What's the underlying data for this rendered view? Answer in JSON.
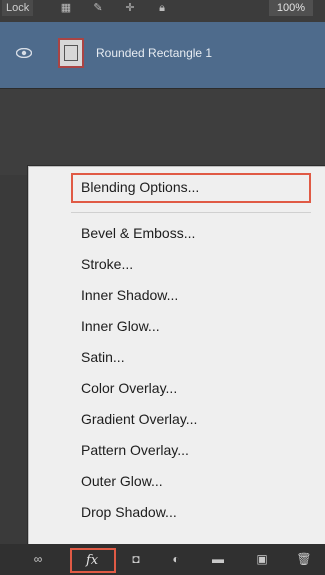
{
  "top_bar": {
    "lock_label": "Lock",
    "fill_value": "100%"
  },
  "layer": {
    "name": "Rounded Rectangle 1"
  },
  "fx_menu": {
    "items": [
      "Blending Options...",
      "Bevel & Emboss...",
      "Stroke...",
      "Inner Shadow...",
      "Inner Glow...",
      "Satin...",
      "Color Overlay...",
      "Gradient Overlay...",
      "Pattern Overlay...",
      "Outer Glow...",
      "Drop Shadow..."
    ],
    "highlighted_item": "Blending Options..."
  },
  "bottom_toolbar": {
    "fx_label": "fx",
    "icons": [
      "link-layers-icon",
      "fx-icon",
      "add-mask-icon",
      "adjustment-layer-icon",
      "new-group-folder-icon",
      "new-layer-icon",
      "delete-layer-icon"
    ]
  },
  "colors": {
    "panel_bg": "#3a3a3a",
    "selected_layer_bg": "#4e6b8c",
    "menu_bg": "#efefef",
    "highlight_stroke": "#e05a45"
  }
}
